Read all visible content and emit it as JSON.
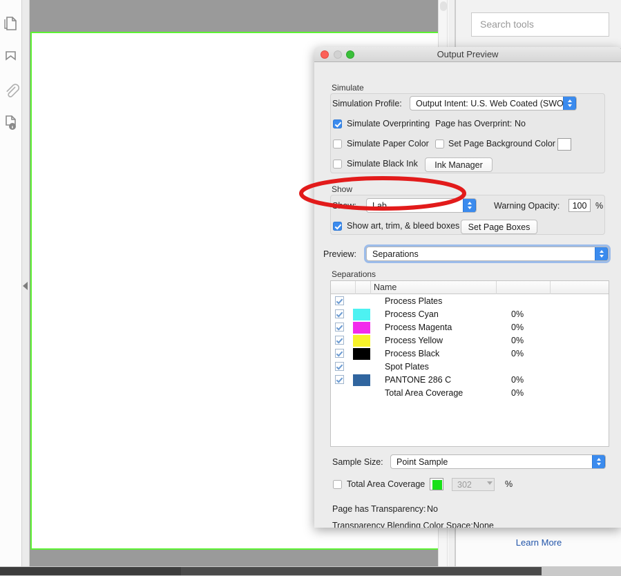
{
  "app": {
    "search_placeholder": "Search tools",
    "learn_more": "Learn More"
  },
  "rail": {
    "icons": [
      {
        "name": "page-thumbnails-icon",
        "label": "Page Thumbnails"
      },
      {
        "name": "bookmarks-icon",
        "label": "Bookmarks"
      },
      {
        "name": "attachments-icon",
        "label": "Attachments"
      },
      {
        "name": "signatures-icon",
        "label": "Signatures"
      }
    ]
  },
  "dialog": {
    "title": "Output Preview",
    "window_controls": {
      "close": "close",
      "minimize": "minimize",
      "zoom": "zoom"
    },
    "simulate": {
      "group_label": "Simulate",
      "profile_label": "Simulation Profile:",
      "profile_value": "Output Intent: U.S. Web Coated (SWOP)…",
      "overprinting_label": "Simulate Overprinting",
      "overprinting_checked": true,
      "page_has_overprint_label": "Page has Overprint:",
      "page_has_overprint_value": "No",
      "paper_color_label": "Simulate Paper Color",
      "paper_color_checked": false,
      "set_page_bg_label": "Set Page Background Color",
      "set_page_bg_checked": false,
      "black_ink_label": "Simulate Black Ink",
      "black_ink_checked": false,
      "ink_manager_button": "Ink Manager"
    },
    "show": {
      "group_label": "Show",
      "show_label": "Show:",
      "show_value": "Lab",
      "warning_opacity_label": "Warning Opacity:",
      "warning_opacity_value": "100",
      "warning_opacity_unit": "%",
      "boxes_label": "Show art, trim, & bleed boxes",
      "boxes_checked": true,
      "set_page_boxes_button": "Set Page Boxes"
    },
    "preview": {
      "label": "Preview:",
      "value": "Separations"
    },
    "separations": {
      "group_label": "Separations",
      "columns": [
        "",
        "",
        "Name",
        "",
        ""
      ],
      "rows": [
        {
          "checked": true,
          "swatch": null,
          "name": "Process Plates",
          "percent": ""
        },
        {
          "checked": true,
          "swatch": "#4DF2F2",
          "name": "Process Cyan",
          "percent": "0%"
        },
        {
          "checked": true,
          "swatch": "#F22BEC",
          "name": "Process Magenta",
          "percent": "0%"
        },
        {
          "checked": true,
          "swatch": "#F7F22B",
          "name": "Process Yellow",
          "percent": "0%"
        },
        {
          "checked": true,
          "swatch": "#000000",
          "name": "Process Black",
          "percent": "0%"
        },
        {
          "checked": true,
          "swatch": null,
          "name": "Spot Plates",
          "percent": ""
        },
        {
          "checked": true,
          "swatch": "#30659F",
          "name": "PANTONE 286 C",
          "percent": "0%"
        },
        {
          "checked": false,
          "swatch": null,
          "name": "Total Area Coverage",
          "percent": "0%"
        }
      ]
    },
    "footer": {
      "sample_size_label": "Sample Size:",
      "sample_size_value": "Point Sample",
      "tac_checkbox_label": "Total Area Coverage",
      "tac_checked": false,
      "tac_swatch_color": "#18E018",
      "tac_value": "302",
      "tac_unit": "%",
      "transparency_label": "Page has Transparency:",
      "transparency_value": "No",
      "blending_label": "Transparency Blending Color Space:",
      "blending_value": "None"
    }
  },
  "annotation": {
    "shape": "ellipse",
    "color": "#E21B1B",
    "target": "Show dropdown"
  },
  "page_view": {
    "page_border_color": "#5CF232",
    "background_color": "#9A9A9A"
  }
}
